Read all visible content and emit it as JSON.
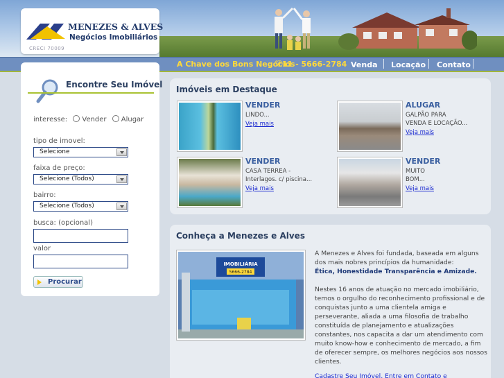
{
  "header": {
    "brand_name": "MENEZES & ALVES",
    "brand_subtitle": "Negócios Imobiliários",
    "creci": "CRECI 70009"
  },
  "nav": {
    "tagline": "A Chave dos Bons Negócios",
    "phone": "11 - 5666-2784",
    "links": [
      "Venda",
      "Locação",
      "Contato"
    ]
  },
  "search": {
    "title": "Encontre Seu Imóvel",
    "interest_label": "interesse:",
    "interest_options": [
      "Vender",
      "Alugar"
    ],
    "type_label": "tipo de imovel:",
    "type_value": "Selecione",
    "price_label": "faixa de preço:",
    "price_value": "Selecione (Todos)",
    "district_label": "bairro:",
    "district_value": "Selecione (Todos)",
    "query_label": "busca: (opcional)",
    "value_label": "valor",
    "button": "Procurar"
  },
  "featured": {
    "title": "Imóveis em Destaque",
    "items": [
      {
        "type": "VENDER",
        "desc": [
          "LINDO..."
        ],
        "more": "Veja mais"
      },
      {
        "type": "ALUGAR",
        "desc": [
          "GALPÃO PARA",
          "VENDA E LOCAÇÃO..."
        ],
        "more": "Veja mais"
      },
      {
        "type": "VENDER",
        "desc": [
          "CASA TERREA -",
          "Interlagos. c/ piscina..."
        ],
        "more": "Veja mais"
      },
      {
        "type": "VENDER",
        "desc": [
          "MUITO",
          "BOM..."
        ],
        "more": "Veja mais"
      }
    ]
  },
  "about": {
    "title": "Conheça a Menezes e Alves",
    "intro": "A Menezes e Alves foi fundada, baseada em alguns dos mais nobres princípios da humanidade:",
    "values": "Ética, Honestidade Transparência e Amizade.",
    "body": "Nestes 16 anos de atuação no mercado imobiliário, temos o orgulho do reconhecimento profissional e de conquistas junto a uma clientela amiga e perseverante, aliada a uma filosofia de trabalho constituída de planejamento e atualizações constantes, nos capacita a dar um atendimento com muito know-how e conhecimento de mercado, a fim de oferecer sempre, os melhores negócios aos nossos clientes.",
    "links": "Cadastre Seu Imóvel, Entre em Contato e",
    "sign_text": "IMOBILIÁRIA",
    "sign_phone": "5666-2784"
  },
  "colors": {
    "nav_blue": "#6f8fc0",
    "accent_yellow": "#ffd93a",
    "accent_green": "#a9c232",
    "heading_blue": "#2b3f60",
    "link_blue": "#1b2ad0"
  }
}
